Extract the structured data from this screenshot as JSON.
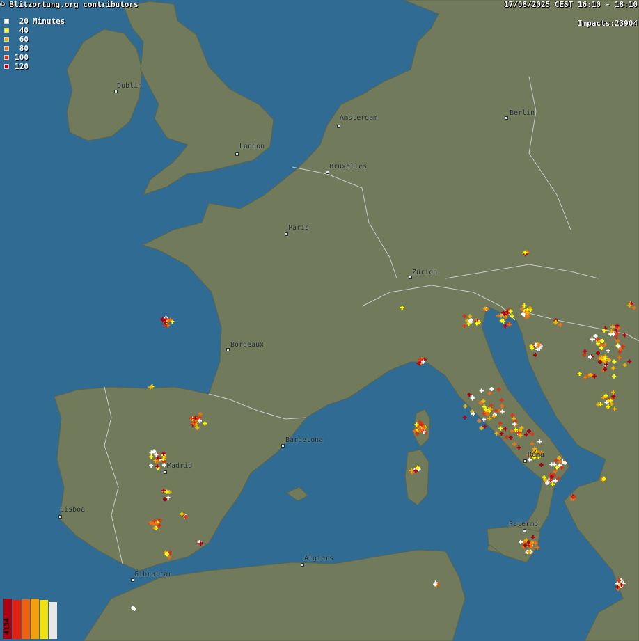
{
  "header": {
    "credit": "© Blitzortung.org contributors",
    "timestamp": "17/08/2025 CEST 16:10 - 18:10",
    "impacts": "Impacts:23904"
  },
  "legend": {
    "items": [
      {
        "age": "20",
        "unit": "Minutes",
        "color": "#ffffff"
      },
      {
        "age": "40",
        "unit": "",
        "color": "#ffff00"
      },
      {
        "age": "60",
        "unit": "",
        "color": "#f0b000"
      },
      {
        "age": "80",
        "unit": "",
        "color": "#f07010"
      },
      {
        "age": "100",
        "unit": "",
        "color": "#e03010"
      },
      {
        "age": "120",
        "unit": "",
        "color": "#b00010"
      }
    ]
  },
  "counter": {
    "value": "4134",
    "bar_colors": [
      "#b00010",
      "#e02010",
      "#f06010",
      "#f0a010",
      "#f0e010",
      "#e8e8e8"
    ]
  },
  "cities": [
    {
      "name": "Dublin"
    },
    {
      "name": "London"
    },
    {
      "name": "Amsterdam"
    },
    {
      "name": "Berlin"
    },
    {
      "name": "Bruxelles"
    },
    {
      "name": "Paris"
    },
    {
      "name": "Zürich"
    },
    {
      "name": "Bordeaux"
    },
    {
      "name": "Barcelona"
    },
    {
      "name": "Madrid"
    },
    {
      "name": "Lisboa"
    },
    {
      "name": "Gibraltar"
    },
    {
      "name": "Algiers"
    },
    {
      "name": "Palermo"
    },
    {
      "name": "Roma"
    }
  ],
  "colors": {
    "sea": "#2f6b93",
    "land": "#727a5c",
    "border": "#cfd3d6"
  }
}
